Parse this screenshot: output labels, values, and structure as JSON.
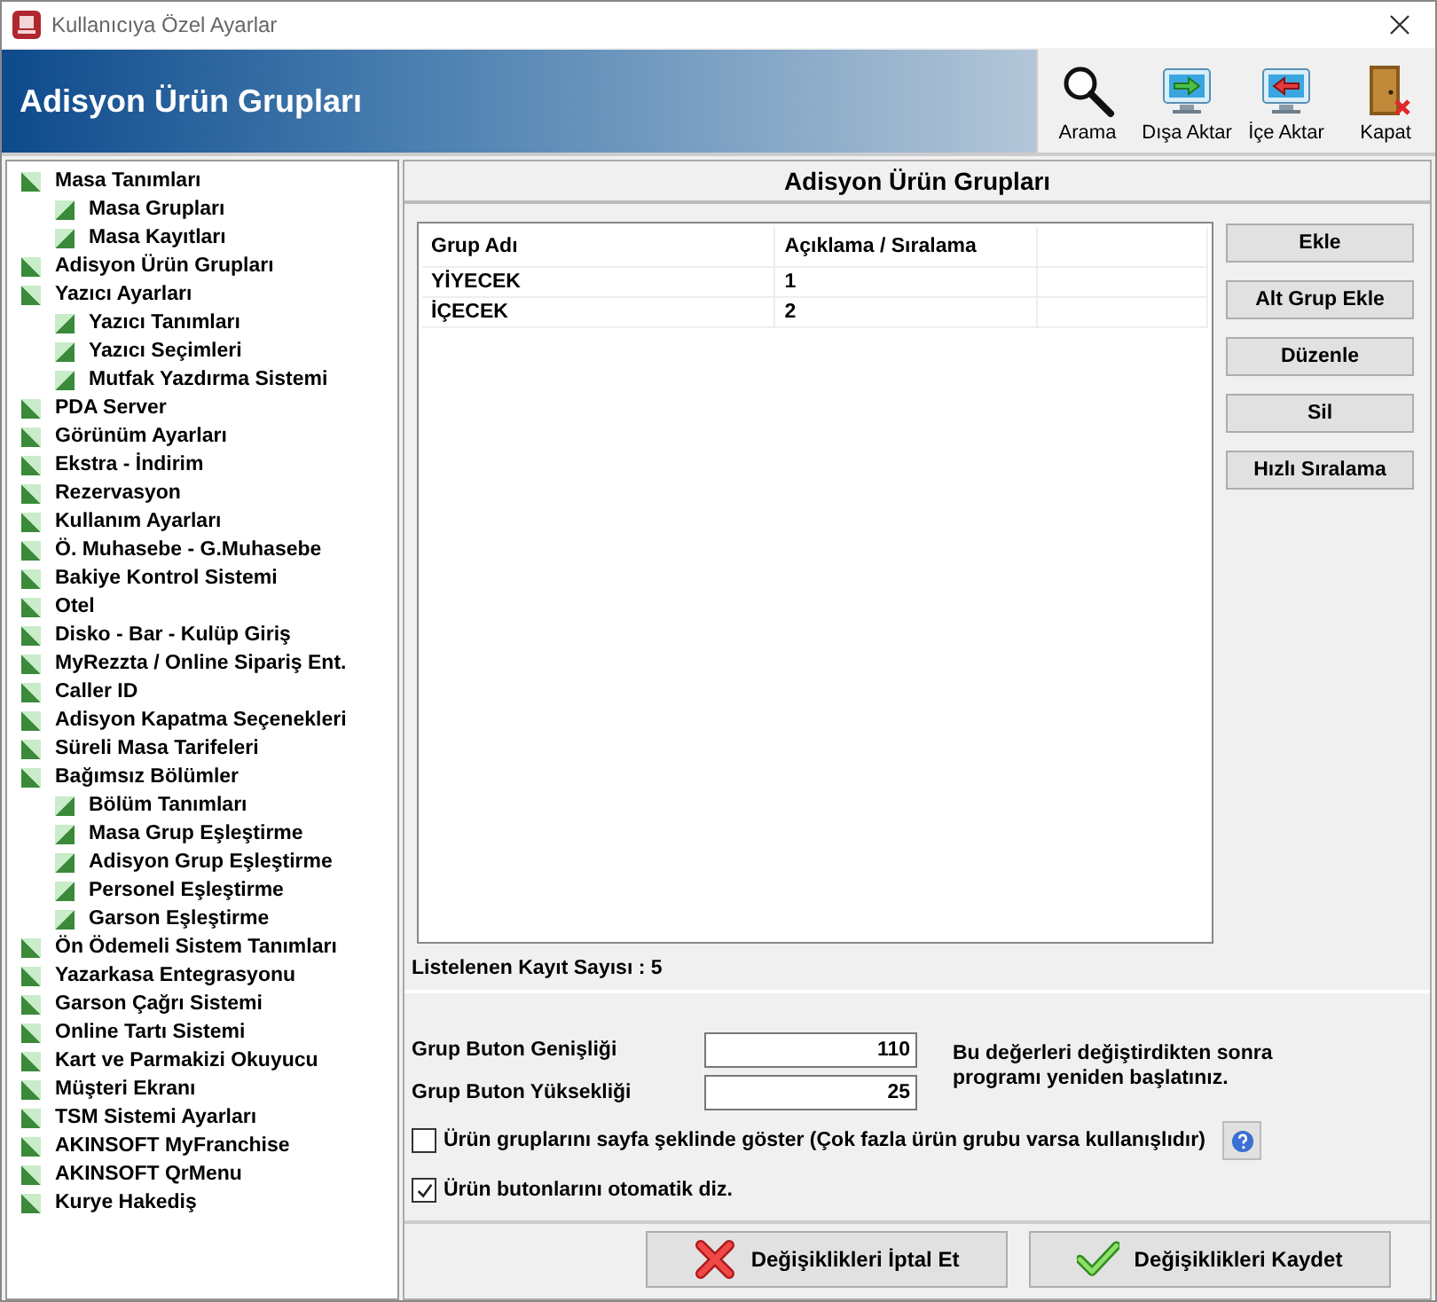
{
  "window": {
    "title": "Kullanıcıya Özel Ayarlar"
  },
  "header": {
    "title": "Adisyon Ürün Grupları"
  },
  "toolbar": [
    {
      "kind": "search",
      "label": "Arama"
    },
    {
      "kind": "export",
      "label": "Dışa Aktar"
    },
    {
      "kind": "import",
      "label": "İçe Aktar"
    },
    {
      "kind": "close",
      "label": "Kapat"
    }
  ],
  "tree": [
    {
      "label": "Masa Tanımları",
      "children": [
        {
          "label": "Masa Grupları"
        },
        {
          "label": "Masa Kayıtları"
        }
      ]
    },
    {
      "label": "Adisyon Ürün Grupları"
    },
    {
      "label": "Yazıcı Ayarları",
      "children": [
        {
          "label": "Yazıcı Tanımları"
        },
        {
          "label": "Yazıcı Seçimleri"
        },
        {
          "label": "Mutfak Yazdırma Sistemi"
        }
      ]
    },
    {
      "label": "PDA Server"
    },
    {
      "label": "Görünüm Ayarları"
    },
    {
      "label": "Ekstra - İndirim"
    },
    {
      "label": "Rezervasyon"
    },
    {
      "label": "Kullanım Ayarları"
    },
    {
      "label": "Ö. Muhasebe - G.Muhasebe"
    },
    {
      "label": "Bakiye Kontrol Sistemi"
    },
    {
      "label": "Otel"
    },
    {
      "label": "Disko - Bar - Kulüp Giriş"
    },
    {
      "label": "MyRezzta / Online Sipariş Ent."
    },
    {
      "label": "Caller ID"
    },
    {
      "label": "Adisyon Kapatma Seçenekleri"
    },
    {
      "label": "Süreli Masa Tarifeleri"
    },
    {
      "label": "Bağımsız Bölümler",
      "children": [
        {
          "label": "Bölüm Tanımları"
        },
        {
          "label": "Masa Grup Eşleştirme"
        },
        {
          "label": "Adisyon Grup Eşleştirme"
        },
        {
          "label": "Personel Eşleştirme"
        },
        {
          "label": "Garson Eşleştirme"
        }
      ]
    },
    {
      "label": "Ön Ödemeli Sistem Tanımları"
    },
    {
      "label": "Yazarkasa Entegrasyonu"
    },
    {
      "label": "Garson Çağrı Sistemi"
    },
    {
      "label": "Online Tartı Sistemi"
    },
    {
      "label": "Kart ve Parmakizi Okuyucu"
    },
    {
      "label": "Müşteri Ekranı"
    },
    {
      "label": "TSM Sistemi Ayarları"
    },
    {
      "label": "AKINSOFT MyFranchise"
    },
    {
      "label": "AKINSOFT QrMenu"
    },
    {
      "label": "Kurye Hakediş"
    }
  ],
  "panel": {
    "title": "Adisyon Ürün Grupları",
    "table": {
      "columns": [
        "Grup Adı",
        "Açıklama / Sıralama"
      ],
      "rows": [
        [
          "YİYECEK",
          "1"
        ],
        [
          "İÇECEK",
          "2"
        ]
      ]
    },
    "buttons": [
      "Ekle",
      "Alt Grup Ekle",
      "Düzenle",
      "Sil",
      "Hızlı Sıralama"
    ],
    "record_count": "Listelenen Kayıt Sayısı : 5",
    "fields": [
      {
        "label": "Grup Buton Genişliği",
        "value": "110"
      },
      {
        "label": "Grup Buton Yüksekliği",
        "value": "25"
      }
    ],
    "note": "Bu değerleri değiştirdikten sonra programı yeniden başlatınız.",
    "checkboxes": [
      {
        "label": "Ürün gruplarını sayfa şeklinde göster (Çok fazla ürün grubu varsa kullanışlıdır)",
        "checked": false,
        "help": true
      },
      {
        "label": "Ürün butonlarını otomatik diz.",
        "checked": true,
        "help": false
      }
    ]
  },
  "footer": [
    {
      "kind": "cancel",
      "label": "Değişiklikleri İptal Et"
    },
    {
      "kind": "save",
      "label": "Değişiklikleri Kaydet"
    }
  ]
}
